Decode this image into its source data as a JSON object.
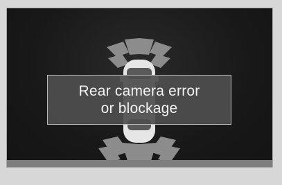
{
  "display": {
    "warning_message": {
      "line1": "Rear camera error",
      "line2": "or blockage"
    }
  },
  "icons": {
    "car": "car-top-view-icon",
    "front_sensors": "front-parking-sensor-zones-icon",
    "rear_sensors": "rear-parking-sensor-zones-icon"
  },
  "colors": {
    "screen_background": "#1b1b1b",
    "sensor_zone": "#8a8a8a",
    "message_box": "#4e4e4e",
    "message_text": "#f3f3f3"
  }
}
